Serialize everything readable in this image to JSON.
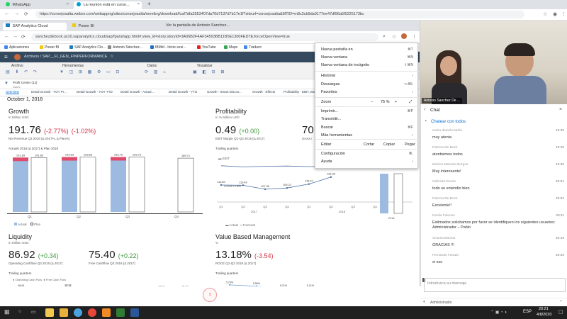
{
  "outer": {
    "tabs": [
      {
        "label": "WhatsApp"
      },
      {
        "label": "La reunión está en curso..."
      },
      {
        "label": "+"
      }
    ],
    "address": "https://consejosalta.webex.com/webappng/sites/consejosalta/meeting/download/fcaf7dfa3553407da70d7137d7b17e1f?siteurl=consejosalta&MTID=m8c3cb9da0177ee47df96a5f5225173bc"
  },
  "inner": {
    "tabs": [
      {
        "label": "SAP Analytics Cloud"
      },
      {
        "label": "Power BI"
      },
      {
        "label": "Ver la pantalla de Antonio Sanchez..."
      }
    ],
    "address": "sanchezdebock.us10.sapanalytics.cloud/sap/fpa/ui/app.html#;view_id=story;storyId=3A06B2F4AF34593BB11B5E1300FED7E;forceOpenView=true",
    "bookmarks": [
      "Aplicaciones",
      "Power BI",
      "SAP Analytics Clo...",
      "Antonio Sánchez...",
      "IBMid - Inicie sesi...",
      "YouTube",
      "Maps",
      "Traducir"
    ]
  },
  "sac": {
    "breadcrumb": "Archivos  /  SAP__FI_GEN_FINPERFORMANCE",
    "toolbar_groups": [
      "Archivo",
      "Herramientas",
      "Datos",
      "Visualizar"
    ],
    "filter_label": "Profit Center (12)",
    "filter_sub": "Dates",
    "page_tabs": [
      "Overview",
      "Detail Growth - YOY Pr...",
      "Detail Growth - YOY YTD",
      "Detail Growth - Actual ...",
      "Detail Growth - YTG",
      "Growth - Smart Discov...",
      "Growth - Effects",
      "Profitability - EBIT, EB..."
    ],
    "date": "October 1, 2018",
    "growth": {
      "title": "Growth",
      "unit": "In Million USD",
      "value": "191.76",
      "delta_abs": "(-2.77%)",
      "delta_rel": "(-1.02%)",
      "label": "Net Revenue Q3 2018 (Δ 2017%, Δ Plan%)",
      "chart_caption": "Actuals 2018 (Δ 2017) & Plan 2018",
      "legend_actual": "Actual",
      "legend_plan": "Plan"
    },
    "profitability": {
      "title": "Profitability",
      "unit": "In % Million USD",
      "value": "0.49",
      "delta": "(+0.00)",
      "label": "EBIT Margin Q1-Q3 2018 (Δ 2017)",
      "value2": "70",
      "label2": "Gross I",
      "chart_caption": "Trailing quarters",
      "legend1": "EBIT",
      "legend2": "Gross Profit",
      "legend_actual": "Actual",
      "legend_forecast": "Forecast"
    },
    "liquidity": {
      "title": "Liquidity",
      "unit": "In Million USD",
      "value1": "86.92",
      "delta1": "(+0.34)",
      "label1": "Operating Cashflow Q3 2018 (Δ 2017)",
      "value2": "75.40",
      "delta2": "(+0.22)",
      "label2": "Free Cashflow Q3 2018 (Δ 2017)",
      "chart_caption": "Trailing quarters",
      "legend1": "Operating Cash Flow",
      "legend2": "Free Cash Flow"
    },
    "vbm": {
      "title": "Value Based Management",
      "unit": "%",
      "value": "13.18%",
      "delta": "(-3.54)",
      "label": "ROCE Q1-Q3 2018 (Δ 2017)",
      "chart_caption": "Trailing quarters"
    }
  },
  "chart_data": [
    {
      "type": "bar",
      "title": "Actuals 2018 (Δ 2017) & Plan 2018",
      "categories": [
        "Q1",
        "Q2",
        "Q3",
        "Q4"
      ],
      "series": [
        {
          "name": "Actual",
          "values": [
            191.83,
            193.63,
            193.79,
            null
          ]
        },
        {
          "name": "Plan",
          "values": [
            191.83,
            193.63,
            193.73,
            189.71
          ]
        }
      ],
      "ylim": [
        0,
        200
      ]
    },
    {
      "type": "line",
      "title": "Trailing quarters",
      "categories": [
        "Q1",
        "Q2",
        "Q3",
        "Q4",
        "Q1",
        "Q2",
        "Q3",
        "Q4"
      ],
      "groups": [
        "2017",
        "2018"
      ],
      "series": [
        {
          "name": "EBIT",
          "values": [
            0.52,
            0.48,
            0.5,
            0.51,
            0.49,
            0.49,
            0.49,
            0.49
          ]
        },
        {
          "name": "Gross Profit",
          "values": [
            113.89,
            113.49,
            107.36,
            109.22,
            115.37,
            126.39,
            null,
            null
          ]
        }
      ]
    },
    {
      "type": "line",
      "title": "Trailing quarters",
      "series": [
        {
          "name": "Operating Cash Flow",
          "values": [
            88.61,
            84.72,
            88.98,
            83.72,
            78.18,
            79.84,
            86.92,
            86.92
          ]
        },
        {
          "name": "Free Cash Flow",
          "values": [
            78.41,
            76.14,
            86.3,
            71.46,
            76.74,
            72.16,
            75.4,
            75.4
          ]
        }
      ]
    },
    {
      "type": "line",
      "title": "Trailing quarters",
      "series": [
        {
          "name": "ROCE",
          "values": [
            5.79,
            5.56,
            5.21,
            5.21,
            4.15,
            4.48,
            4.47
          ]
        }
      ]
    }
  ],
  "menu": {
    "items": [
      {
        "label": "Nueva pestaña en",
        "shortcut": "⌘T"
      },
      {
        "label": "Nueva ventana",
        "shortcut": "⌘N"
      },
      {
        "label": "Nueva ventana de incógnito",
        "shortcut": "⇧⌘N"
      },
      {
        "label": "Historial",
        "shortcut": "›"
      },
      {
        "label": "Descargas",
        "shortcut": "⌥⌘L"
      },
      {
        "label": "Favoritos",
        "shortcut": "›"
      },
      {
        "label": "Zoom",
        "shortcut": ""
      },
      {
        "label": "Imprimir...",
        "shortcut": "⌘P"
      },
      {
        "label": "Transmitir...",
        "shortcut": ""
      },
      {
        "label": "Buscar",
        "shortcut": "⌘F"
      },
      {
        "label": "Más herramientas",
        "shortcut": "›"
      },
      {
        "label": "Editar",
        "shortcut": ""
      },
      {
        "label": "Configuración",
        "shortcut": "⌘,"
      },
      {
        "label": "Ayuda",
        "shortcut": "›"
      }
    ],
    "zoom_minus": "–",
    "zoom_value": "75 %",
    "zoom_plus": "+",
    "edit_cut": "Cortar",
    "edit_copy": "Copiar",
    "edit_paste": "Pegar"
  },
  "video": {
    "name_label": "Antonio Sanchez De ..."
  },
  "chat": {
    "title": "Chat",
    "link": "Chatear con todos",
    "messages": [
      {
        "name": "maria daniela bartlo",
        "text": "muy atenta",
        "time": "19:40"
      },
      {
        "name": "Patricia De Bock",
        "text": "atentisimos todos",
        "time": "19:40"
      },
      {
        "name": "Mónica Marcela Burgos",
        "text": "Muy interesante!",
        "time": "19:40"
      },
      {
        "name": "Gabriela Rosso",
        "text": "todo se entendio bien",
        "time": "20:01"
      },
      {
        "name": "Patricia De Bock",
        "text": "Excelente!!",
        "time": "20:02"
      },
      {
        "name": "Noelia Falcone",
        "text": "Estimados solicitamos por favor se identifiquen los siguientes usuarios: Administrador – Pablo",
        "time": "20:11"
      },
      {
        "name": "Victoria Barrios",
        "text": "GRACIAS !!!",
        "time": "20:19"
      },
      {
        "name": "Fernando Farado",
        "text": "si eso",
        "time": "20:20"
      }
    ],
    "input_placeholder": "Introduzca su mensaje",
    "recipient": "Administrador"
  },
  "taskbar": {
    "lang": "ESP",
    "time": "20:21",
    "date": "4/8/2020"
  },
  "colors": {
    "accent": "#0a6ed1",
    "bar_actual": "#9dbbe0",
    "bar_delta": "#e14b6b",
    "negative": "#d6344a",
    "positive": "#3a9a3a",
    "shell": "#354a5f"
  }
}
